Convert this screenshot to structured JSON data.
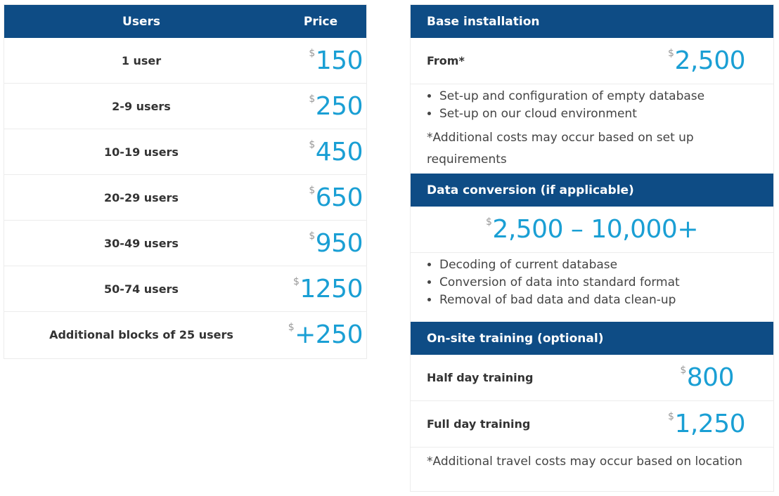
{
  "users_table": {
    "header": {
      "users": "Users",
      "price": "Price"
    },
    "currency": "$",
    "rows": [
      {
        "label": "1 user",
        "price": "150"
      },
      {
        "label": "2-9 users",
        "price": "250"
      },
      {
        "label": "10-19 users",
        "price": "450"
      },
      {
        "label": "20-29 users",
        "price": "650"
      },
      {
        "label": "30-49 users",
        "price": "950"
      },
      {
        "label": "50-74 users",
        "price": "1250"
      },
      {
        "label": "Additional blocks of 25 users",
        "price": "+250"
      }
    ]
  },
  "base_installation": {
    "title": "Base installation",
    "label": "From*",
    "currency": "$",
    "price": "2,500",
    "bullets": [
      "Set-up and configuration of empty database",
      "Set-up on our cloud environment"
    ],
    "note": "*Additional costs may occur based on set up requirements"
  },
  "data_conversion": {
    "title": "Data conversion (if applicable)",
    "currency": "$",
    "price": "2,500 – 10,000+",
    "bullets": [
      "Decoding of current database",
      "Conversion of data into standard format",
      "Removal of bad data and data clean-up"
    ]
  },
  "training": {
    "title": "On-site training (optional)",
    "currency": "$",
    "rows": [
      {
        "label": "Half day training",
        "price": "800"
      },
      {
        "label": "Full day training",
        "price": "1,250"
      }
    ],
    "note": "*Additional travel costs may occur based on location"
  },
  "colors": {
    "header_bg": "#0e4c85",
    "price": "#1a9fd4",
    "currency": "#999999"
  }
}
